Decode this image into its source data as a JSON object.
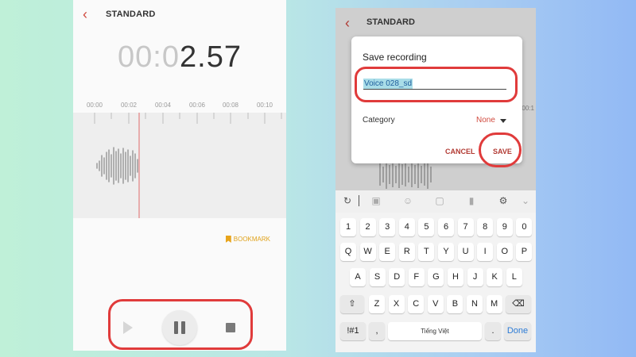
{
  "left": {
    "title": "STANDARD",
    "timer_dim": "00:0",
    "timer_main": "2.57",
    "ticks": [
      "00:00",
      "00:02",
      "00:04",
      "00:06",
      "00:08",
      "00:10"
    ],
    "bookmark_label": "BOOKMARK",
    "accent": "#e03b3b",
    "bookmark_color": "#e0a21a"
  },
  "right": {
    "title": "STANDARD",
    "tick_hint": "00:1",
    "dialog": {
      "title": "Save recording",
      "name_value": "Voice 028_sd",
      "category_label": "Category",
      "category_value": "None",
      "cancel_label": "CANCEL",
      "save_label": "SAVE"
    },
    "toolbar_icons": [
      "handwriting-icon",
      "image-icon",
      "emoji-icon",
      "sticker-icon",
      "mic-icon",
      "gear-icon",
      "chevron-down-icon"
    ],
    "keyboard": {
      "row_numbers": [
        "1",
        "2",
        "3",
        "4",
        "5",
        "6",
        "7",
        "8",
        "9",
        "0"
      ],
      "row_top": [
        "Q",
        "W",
        "E",
        "R",
        "T",
        "Y",
        "U",
        "I",
        "O",
        "P"
      ],
      "row_mid": [
        "A",
        "S",
        "D",
        "F",
        "G",
        "H",
        "J",
        "K",
        "L"
      ],
      "row_bottom": [
        "Z",
        "X",
        "C",
        "V",
        "B",
        "N",
        "M"
      ],
      "symbols_label": "!#1",
      "comma_label": ",",
      "space_label": "Tiếng Việt",
      "period_label": ".",
      "done_label": "Done"
    }
  }
}
